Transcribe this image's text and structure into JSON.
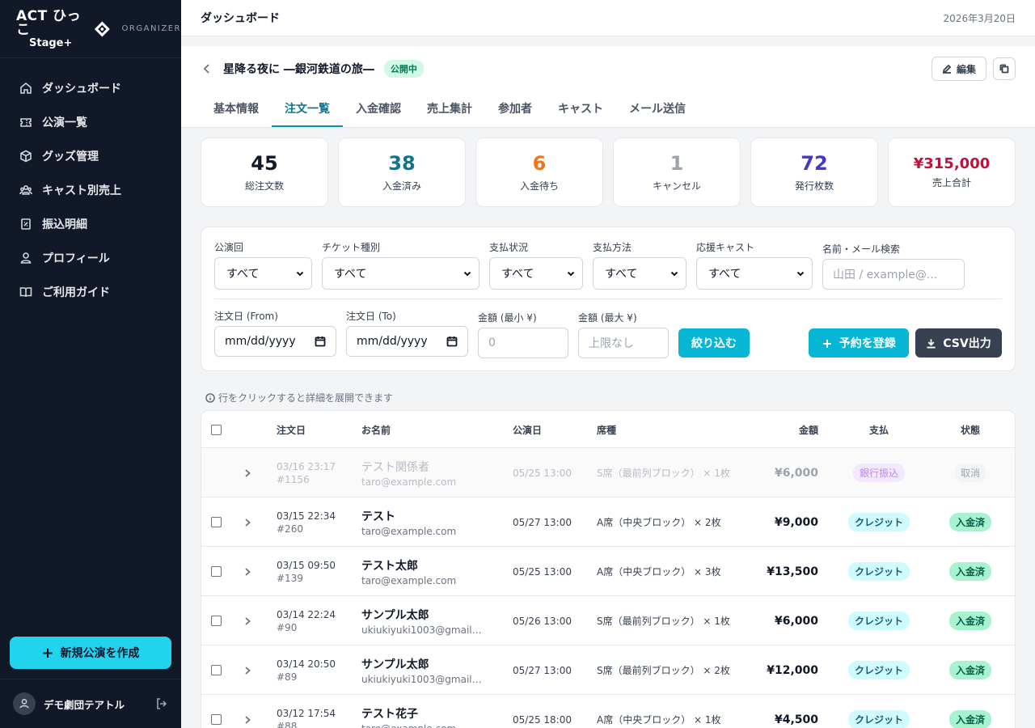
{
  "brand": {
    "line1": "ACT ひっこ",
    "line2": "Stage+",
    "subtitle": "ORGANIZER"
  },
  "sidebar": {
    "items": [
      {
        "label": "ダッシュボード",
        "icon": "home-icon"
      },
      {
        "label": "公演一覧",
        "icon": "ticket-icon"
      },
      {
        "label": "グッズ管理",
        "icon": "box-icon"
      },
      {
        "label": "キャスト別売上",
        "icon": "users-icon"
      },
      {
        "label": "振込明細",
        "icon": "receipt-icon"
      },
      {
        "label": "プロフィール",
        "icon": "user-icon"
      },
      {
        "label": "ご利用ガイド",
        "icon": "book-icon"
      }
    ],
    "create_label": "新規公演を作成",
    "org_name": "デモ劇団テアトル"
  },
  "topbar": {
    "title": "ダッシュボード",
    "date": "2026年3月20日"
  },
  "show": {
    "title": "星降る夜に ―銀河鉄道の旅―",
    "status": "公開中",
    "edit_label": "編集"
  },
  "tabs": [
    {
      "label": "基本情報",
      "active": false
    },
    {
      "label": "注文一覧",
      "active": true
    },
    {
      "label": "入金確認",
      "active": false
    },
    {
      "label": "売上集計",
      "active": false
    },
    {
      "label": "参加者",
      "active": false
    },
    {
      "label": "キャスト",
      "active": false
    },
    {
      "label": "メール送信",
      "active": false
    }
  ],
  "stats": [
    {
      "value": "45",
      "label": "総注文数",
      "color": "#111827"
    },
    {
      "value": "38",
      "label": "入金済み",
      "color": "#0e7490"
    },
    {
      "value": "6",
      "label": "入金待ち",
      "color": "#f97316"
    },
    {
      "value": "1",
      "label": "キャンセル",
      "color": "#9ca3af"
    },
    {
      "value": "72",
      "label": "発行枚数",
      "color": "#4338ca"
    },
    {
      "value": "¥315,000",
      "label": "売上合計",
      "color": "#be123c"
    }
  ],
  "filters": {
    "performance": {
      "label": "公演回",
      "value": "すべて"
    },
    "ticket_type": {
      "label": "チケット種別",
      "value": "すべて"
    },
    "payment_status": {
      "label": "支払状況",
      "value": "すべて"
    },
    "payment_method": {
      "label": "支払方法",
      "value": "すべて"
    },
    "cast": {
      "label": "応援キャスト",
      "value": "すべて"
    },
    "search": {
      "label": "名前・メール検索",
      "placeholder": "山田 / example@..."
    },
    "date_from": {
      "label": "注文日 (From)",
      "value": "mm/dd/yyyy"
    },
    "date_to": {
      "label": "注文日 (To)",
      "value": "mm/dd/yyyy"
    },
    "amount_min": {
      "label": "金額 (最小 ¥)",
      "placeholder": "0"
    },
    "amount_max": {
      "label": "金額 (最大 ¥)",
      "placeholder": "上限なし"
    },
    "apply_label": "絞り込む",
    "register_label": "予約を登録",
    "csv_label": "CSV出力"
  },
  "hint": "行をクリックすると詳細を展開できます",
  "table": {
    "headers": {
      "order_date": "注文日",
      "name": "お名前",
      "show_date": "公演日",
      "seat": "席種",
      "amount": "金額",
      "payment": "支払",
      "status": "状態"
    },
    "rows": [
      {
        "date": "03/16 23:17",
        "id": "#1156",
        "name": "テスト関係者",
        "email": "taro@example.com",
        "show_date": "05/25 13:00",
        "seat": "S席（最前列ブロック） × 1枚",
        "amount": "¥6,000",
        "payment": "銀行振込",
        "status": "取消",
        "cancelled": true
      },
      {
        "date": "03/15 22:34",
        "id": "#260",
        "name": "テスト",
        "email": "taro@example.com",
        "show_date": "05/27 13:00",
        "seat": "A席（中央ブロック） × 2枚",
        "amount": "¥9,000",
        "payment": "クレジット",
        "status": "入金済",
        "cancelled": false
      },
      {
        "date": "03/15 09:50",
        "id": "#139",
        "name": "テスト太郎",
        "email": "taro@example.com",
        "show_date": "05/25 13:00",
        "seat": "A席（中央ブロック） × 3枚",
        "amount": "¥13,500",
        "payment": "クレジット",
        "status": "入金済",
        "cancelled": false
      },
      {
        "date": "03/14 22:24",
        "id": "#90",
        "name": "サンプル太郎",
        "email": "ukiukiyuki1003@gmail…",
        "show_date": "05/26 13:00",
        "seat": "S席（最前列ブロック） × 1枚",
        "amount": "¥6,000",
        "payment": "クレジット",
        "status": "入金済",
        "cancelled": false
      },
      {
        "date": "03/14 20:50",
        "id": "#89",
        "name": "サンプル太郎",
        "email": "ukiukiyuki1003@gmail…",
        "show_date": "05/27 13:00",
        "seat": "S席（最前列ブロック） × 2枚",
        "amount": "¥12,000",
        "payment": "クレジット",
        "status": "入金済",
        "cancelled": false
      },
      {
        "date": "03/12 17:54",
        "id": "#88",
        "name": "テスト花子",
        "email": "taro@example.com",
        "show_date": "05/25 18:00",
        "seat": "A席（中央ブロック） × 1枚",
        "amount": "¥4,500",
        "payment": "クレジット",
        "status": "入金済",
        "cancelled": false
      }
    ]
  }
}
